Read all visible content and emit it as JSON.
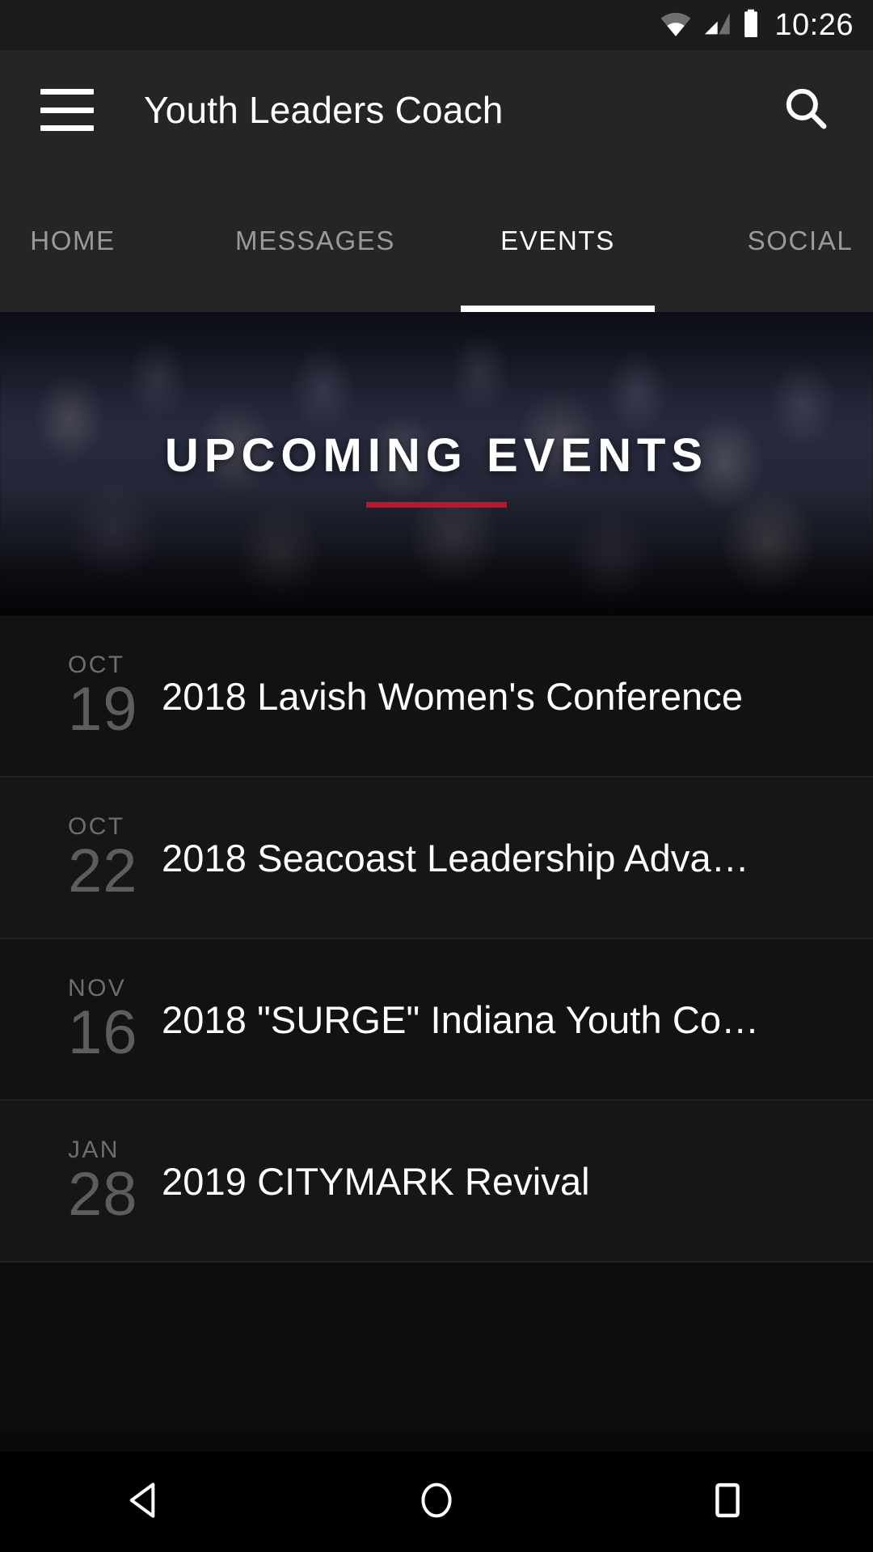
{
  "status_bar": {
    "time": "10:26",
    "icons": [
      "wifi-icon",
      "cellular-signal-icon",
      "battery-icon"
    ]
  },
  "app_bar": {
    "menu_icon": "hamburger-menu-icon",
    "title": "Youth Leaders Coach",
    "search_icon": "search-icon"
  },
  "tabs": {
    "active_index": 2,
    "items": [
      {
        "label": "HOME"
      },
      {
        "label": "MESSAGES"
      },
      {
        "label": "EVENTS"
      },
      {
        "label": "SOCIAL"
      }
    ]
  },
  "hero": {
    "title": "UPCOMING EVENTS",
    "accent_color": "#c0152b",
    "image_alt": "crowd-of-people-with-raised-hands-at-worship-event"
  },
  "events": [
    {
      "month": "OCT",
      "day": "19",
      "title": "2018 Lavish Women's Conference"
    },
    {
      "month": "OCT",
      "day": "22",
      "title": "2018 Seacoast Leadership Adva…"
    },
    {
      "month": "NOV",
      "day": "16",
      "title": "2018 \"SURGE\" Indiana Youth Co…"
    },
    {
      "month": "JAN",
      "day": "28",
      "title": "2019 CITYMARK Revival"
    }
  ],
  "nav_bar": {
    "back": "back-triangle-icon",
    "home": "home-circle-icon",
    "recents": "recents-square-icon"
  },
  "colors": {
    "app_bar_bg": "#252525",
    "status_bar_bg": "#1c1c1c",
    "page_bg": "#121212",
    "tab_active": "#ffffff",
    "tab_inactive": "#9a9a9a",
    "accent_red": "#c0152b"
  }
}
